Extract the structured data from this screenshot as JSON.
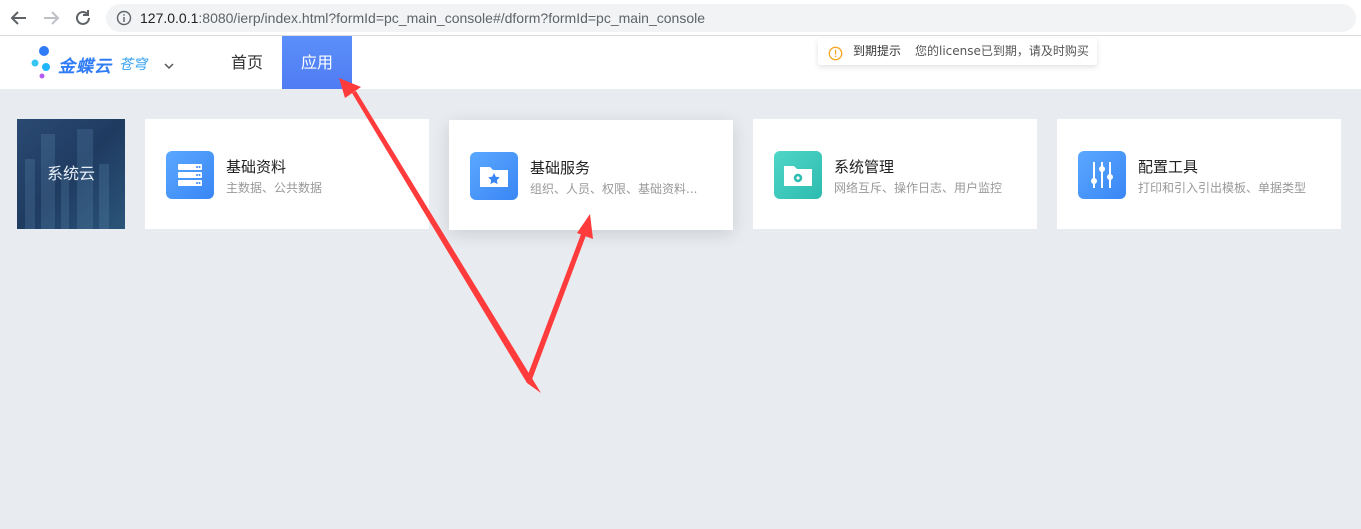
{
  "browser": {
    "url_host": "127.0.0.1",
    "url_rest": ":8080/ierp/index.html?formId=pc_main_console#/dform?formId=pc_main_console",
    "icons": [
      "back-arrow-icon",
      "forward-arrow-icon",
      "reload-icon",
      "info-icon"
    ]
  },
  "header": {
    "logo_text": "金蝶云",
    "logo_sub": "苍穹",
    "nav": [
      {
        "label": "首页",
        "active": false
      },
      {
        "label": "应用",
        "active": true
      }
    ],
    "license_tip": {
      "title": "到期提示",
      "message": "您的license已到期，请及时购买"
    },
    "active_color": "#5b8ff9"
  },
  "sidebar_tile": {
    "label": "系统云"
  },
  "cards": [
    {
      "title": "基础资料",
      "desc": "主数据、公共数据",
      "icon": "database-icon",
      "color": "blue"
    },
    {
      "title": "基础服务",
      "desc": "组织、人员、权限、基础资料...",
      "icon": "folder-star-icon",
      "color": "blue"
    },
    {
      "title": "系统管理",
      "desc": "网络互斥、操作日志、用户监控",
      "icon": "folder-gear-icon",
      "color": "teal"
    },
    {
      "title": "配置工具",
      "desc": "打印和引入引出模板、单据类型",
      "icon": "sliders-icon",
      "color": "blue"
    }
  ],
  "annotation_color": "#ff3b3b"
}
